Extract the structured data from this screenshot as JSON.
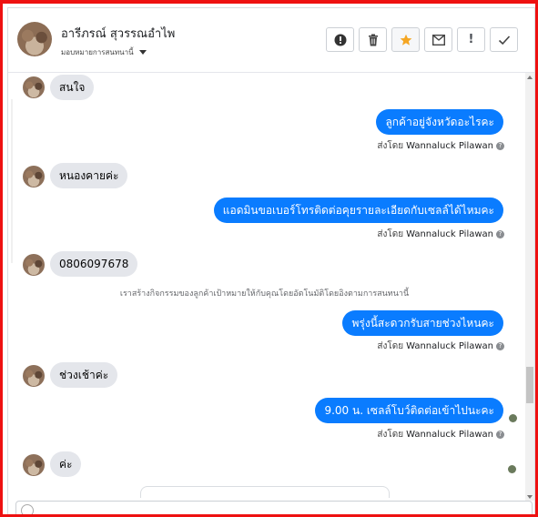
{
  "contact": {
    "name": "อารีภรณ์ สุวรรณอำไพ",
    "assign_label": "มอบหมายการสนทนานี้"
  },
  "toolbar": [
    {
      "name": "alert-icon-button",
      "glyph": "!",
      "icon": "exclamation-circle-icon"
    },
    {
      "name": "delete-button",
      "glyph": "🗑",
      "icon": "trash-icon"
    },
    {
      "name": "star-button",
      "glyph": "★",
      "icon": "star-icon"
    },
    {
      "name": "mark-unread-button",
      "glyph": "✉",
      "icon": "envelope-icon"
    },
    {
      "name": "mark-spam-button",
      "glyph": "!",
      "icon": "exclamation-icon"
    },
    {
      "name": "done-button",
      "glyph": "✓",
      "icon": "check-icon"
    }
  ],
  "messages": {
    "m1": "สนใจ",
    "m2": "ลูกค้าอยู่จังหวัดอะไรคะ",
    "m3": "หนองคายค่ะ",
    "m4": "แอดมินขอเบอร์โทรติดต่อคุยรายละเอียดกับเซลล์ได้ไหมคะ",
    "m5": "0806097678",
    "m6": "พรุ่งนี้สะดวกรับสายช่วงไหนคะ",
    "m7": "ช่วงเช้าค่ะ",
    "m8": "9.00 น. เซลล์โบว์ติดต่อเข้าไปนะคะ",
    "m9": "ค่ะ"
  },
  "sent_prefix": "ส่งโดย",
  "sent_by": "Wannaluck Pilawan",
  "system_note": "เราสร้างกิจกรรมของลูกค้าเป้าหมายให้กับคุณโดยอัตโนมัติโดยอิงตามการสนทนานี้",
  "colors": {
    "outgoing": "#0a7cff",
    "incoming": "#e4e6eb",
    "star": "#f5a623",
    "frame": "#ee1111"
  }
}
